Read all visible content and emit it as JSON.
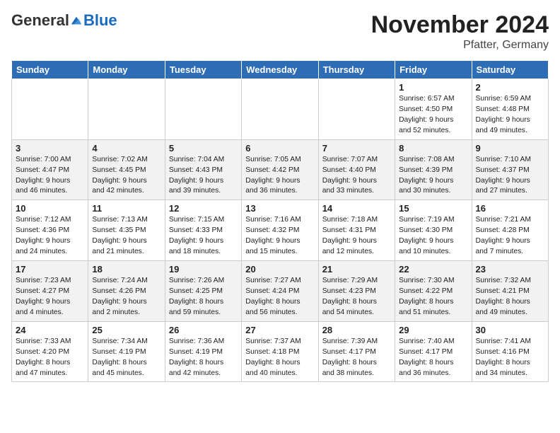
{
  "logo": {
    "general": "General",
    "blue": "Blue"
  },
  "title": "November 2024",
  "location": "Pfatter, Germany",
  "days_header": [
    "Sunday",
    "Monday",
    "Tuesday",
    "Wednesday",
    "Thursday",
    "Friday",
    "Saturday"
  ],
  "weeks": [
    [
      {
        "day": "",
        "info": ""
      },
      {
        "day": "",
        "info": ""
      },
      {
        "day": "",
        "info": ""
      },
      {
        "day": "",
        "info": ""
      },
      {
        "day": "",
        "info": ""
      },
      {
        "day": "1",
        "info": "Sunrise: 6:57 AM\nSunset: 4:50 PM\nDaylight: 9 hours\nand 52 minutes."
      },
      {
        "day": "2",
        "info": "Sunrise: 6:59 AM\nSunset: 4:48 PM\nDaylight: 9 hours\nand 49 minutes."
      }
    ],
    [
      {
        "day": "3",
        "info": "Sunrise: 7:00 AM\nSunset: 4:47 PM\nDaylight: 9 hours\nand 46 minutes."
      },
      {
        "day": "4",
        "info": "Sunrise: 7:02 AM\nSunset: 4:45 PM\nDaylight: 9 hours\nand 42 minutes."
      },
      {
        "day": "5",
        "info": "Sunrise: 7:04 AM\nSunset: 4:43 PM\nDaylight: 9 hours\nand 39 minutes."
      },
      {
        "day": "6",
        "info": "Sunrise: 7:05 AM\nSunset: 4:42 PM\nDaylight: 9 hours\nand 36 minutes."
      },
      {
        "day": "7",
        "info": "Sunrise: 7:07 AM\nSunset: 4:40 PM\nDaylight: 9 hours\nand 33 minutes."
      },
      {
        "day": "8",
        "info": "Sunrise: 7:08 AM\nSunset: 4:39 PM\nDaylight: 9 hours\nand 30 minutes."
      },
      {
        "day": "9",
        "info": "Sunrise: 7:10 AM\nSunset: 4:37 PM\nDaylight: 9 hours\nand 27 minutes."
      }
    ],
    [
      {
        "day": "10",
        "info": "Sunrise: 7:12 AM\nSunset: 4:36 PM\nDaylight: 9 hours\nand 24 minutes."
      },
      {
        "day": "11",
        "info": "Sunrise: 7:13 AM\nSunset: 4:35 PM\nDaylight: 9 hours\nand 21 minutes."
      },
      {
        "day": "12",
        "info": "Sunrise: 7:15 AM\nSunset: 4:33 PM\nDaylight: 9 hours\nand 18 minutes."
      },
      {
        "day": "13",
        "info": "Sunrise: 7:16 AM\nSunset: 4:32 PM\nDaylight: 9 hours\nand 15 minutes."
      },
      {
        "day": "14",
        "info": "Sunrise: 7:18 AM\nSunset: 4:31 PM\nDaylight: 9 hours\nand 12 minutes."
      },
      {
        "day": "15",
        "info": "Sunrise: 7:19 AM\nSunset: 4:30 PM\nDaylight: 9 hours\nand 10 minutes."
      },
      {
        "day": "16",
        "info": "Sunrise: 7:21 AM\nSunset: 4:28 PM\nDaylight: 9 hours\nand 7 minutes."
      }
    ],
    [
      {
        "day": "17",
        "info": "Sunrise: 7:23 AM\nSunset: 4:27 PM\nDaylight: 9 hours\nand 4 minutes."
      },
      {
        "day": "18",
        "info": "Sunrise: 7:24 AM\nSunset: 4:26 PM\nDaylight: 9 hours\nand 2 minutes."
      },
      {
        "day": "19",
        "info": "Sunrise: 7:26 AM\nSunset: 4:25 PM\nDaylight: 8 hours\nand 59 minutes."
      },
      {
        "day": "20",
        "info": "Sunrise: 7:27 AM\nSunset: 4:24 PM\nDaylight: 8 hours\nand 56 minutes."
      },
      {
        "day": "21",
        "info": "Sunrise: 7:29 AM\nSunset: 4:23 PM\nDaylight: 8 hours\nand 54 minutes."
      },
      {
        "day": "22",
        "info": "Sunrise: 7:30 AM\nSunset: 4:22 PM\nDaylight: 8 hours\nand 51 minutes."
      },
      {
        "day": "23",
        "info": "Sunrise: 7:32 AM\nSunset: 4:21 PM\nDaylight: 8 hours\nand 49 minutes."
      }
    ],
    [
      {
        "day": "24",
        "info": "Sunrise: 7:33 AM\nSunset: 4:20 PM\nDaylight: 8 hours\nand 47 minutes."
      },
      {
        "day": "25",
        "info": "Sunrise: 7:34 AM\nSunset: 4:19 PM\nDaylight: 8 hours\nand 45 minutes."
      },
      {
        "day": "26",
        "info": "Sunrise: 7:36 AM\nSunset: 4:19 PM\nDaylight: 8 hours\nand 42 minutes."
      },
      {
        "day": "27",
        "info": "Sunrise: 7:37 AM\nSunset: 4:18 PM\nDaylight: 8 hours\nand 40 minutes."
      },
      {
        "day": "28",
        "info": "Sunrise: 7:39 AM\nSunset: 4:17 PM\nDaylight: 8 hours\nand 38 minutes."
      },
      {
        "day": "29",
        "info": "Sunrise: 7:40 AM\nSunset: 4:17 PM\nDaylight: 8 hours\nand 36 minutes."
      },
      {
        "day": "30",
        "info": "Sunrise: 7:41 AM\nSunset: 4:16 PM\nDaylight: 8 hours\nand 34 minutes."
      }
    ]
  ]
}
